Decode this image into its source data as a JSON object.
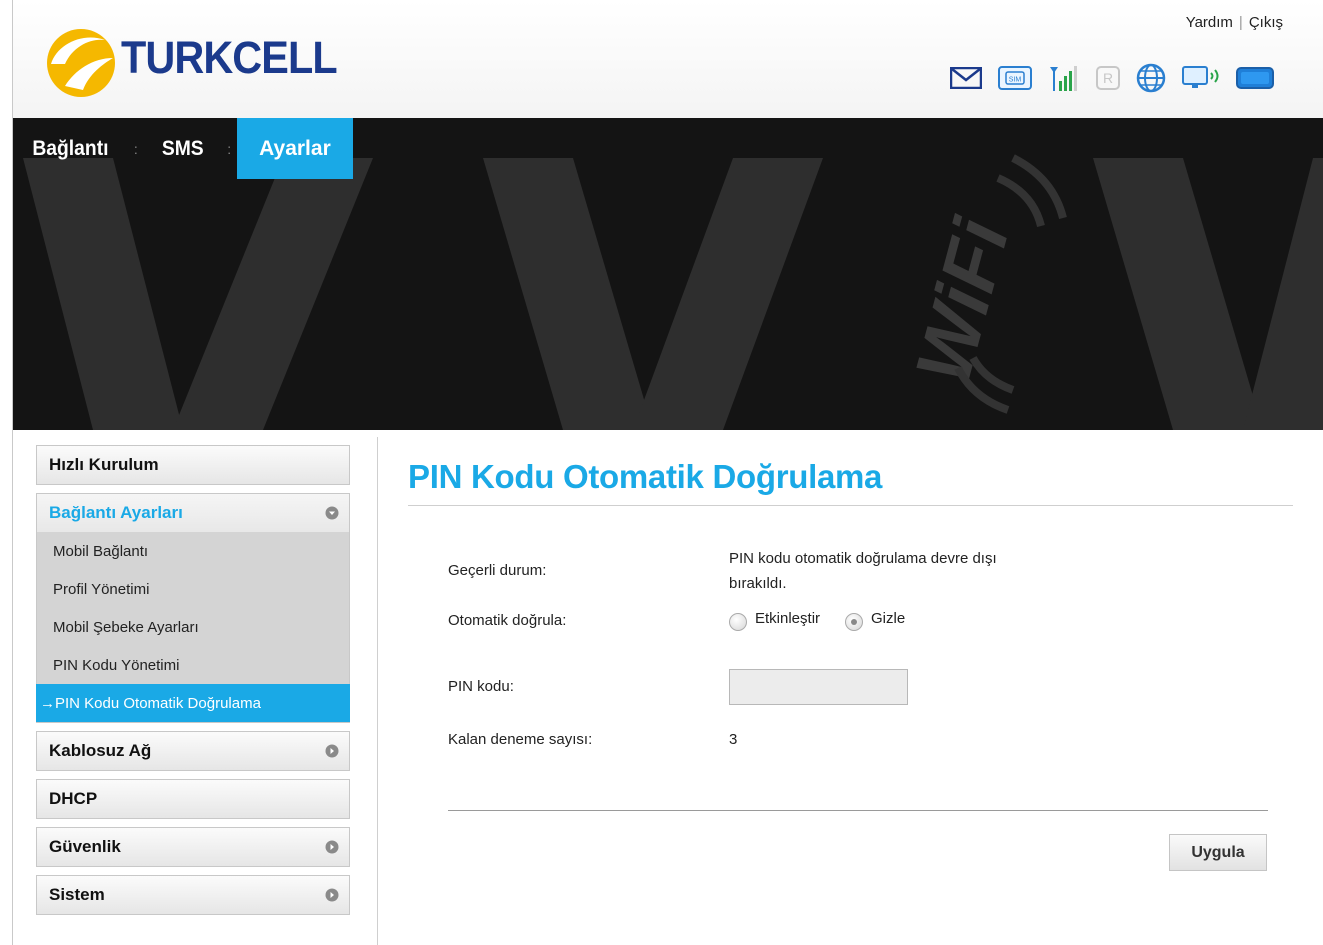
{
  "header": {
    "brand": "TURKCELL",
    "links": {
      "help": "Yardım",
      "logout": "Çıkış"
    },
    "status_icons": [
      "envelope-icon",
      "sim-card-icon",
      "signal-strength-icon",
      "roaming-icon",
      "globe-icon",
      "connected-device-icon",
      "battery-icon"
    ]
  },
  "nav": {
    "items": [
      {
        "label": "Bağlantı",
        "active": false
      },
      {
        "label": "SMS",
        "active": false
      },
      {
        "label": "Ayarlar",
        "active": true
      }
    ],
    "separator": ":"
  },
  "banner": {
    "wifi_text": "WiFi"
  },
  "sidebar": {
    "quick_setup": "Hızlı Kurulum",
    "connection_settings": {
      "label": "Bağlantı Ayarları",
      "items": [
        "Mobil Bağlantı",
        "Profil Yönetimi",
        "Mobil Şebeke Ayarları",
        "PIN Kodu Yönetimi",
        "→PIN Kodu Otomatik Doğrulama"
      ]
    },
    "wireless": "Kablosuz Ağ",
    "dhcp": "DHCP",
    "security": "Güvenlik",
    "system": "Sistem"
  },
  "main": {
    "title": "PIN Kodu Otomatik Doğrulama",
    "current_status_label": "Geçerli durum:",
    "current_status_value_line1": "PIN kodu otomatik doğrulama devre dışı",
    "current_status_value_line2": "bırakıldı.",
    "auto_verify_label": "Otomatik doğrula:",
    "option_enable": "Etkinleştir",
    "option_hide": "Gizle",
    "selected_option": "Gizle",
    "pin_label": "PIN kodu:",
    "pin_value": "",
    "remaining_label": "Kalan deneme sayısı:",
    "remaining_value": "3",
    "apply_label": "Uygula"
  },
  "colors": {
    "accent": "#1aa9e6",
    "brand": "#1b3a8c",
    "logo_yellow": "#f5b800"
  }
}
